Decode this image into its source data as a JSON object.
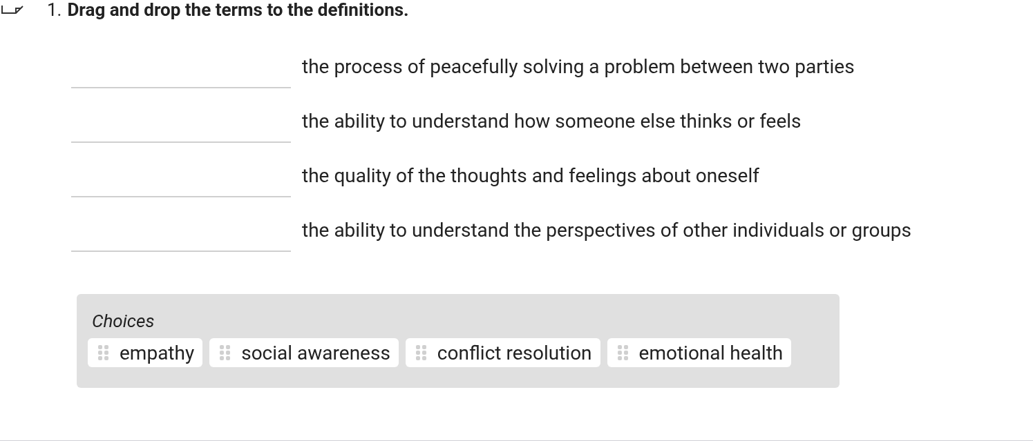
{
  "question": {
    "number": "1.",
    "prompt": "Drag and drop the terms to the definitions."
  },
  "definitions": [
    {
      "text": "the process of peacefully solving a problem between two parties"
    },
    {
      "text": "the ability to understand how someone else thinks or feels"
    },
    {
      "text": "the quality of the thoughts and feelings about oneself"
    },
    {
      "text": "the ability to understand the perspectives of other individuals or groups"
    }
  ],
  "choices": {
    "title": "Choices",
    "items": [
      "empathy",
      "social awareness",
      "conflict resolution",
      "emotional health"
    ]
  }
}
